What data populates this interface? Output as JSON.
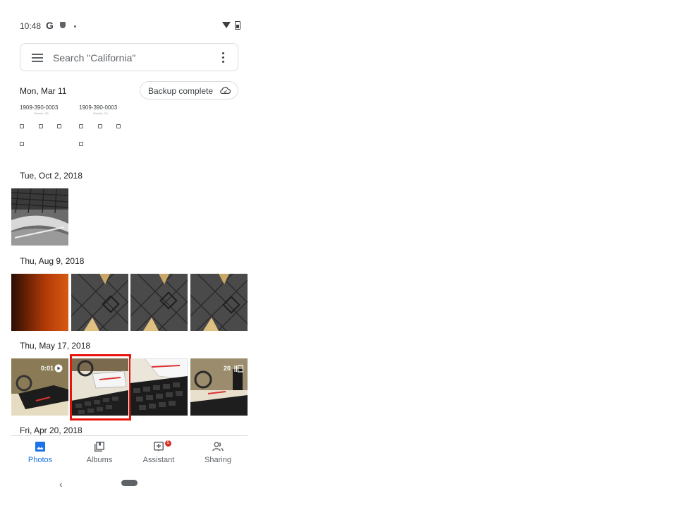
{
  "status_bar": {
    "time": "10:48",
    "g_letter": "G"
  },
  "search": {
    "placeholder": "Search \"California\""
  },
  "sections": {
    "mar11": {
      "date": "Mon, Mar 11",
      "backup_label": "Backup complete",
      "call_number_1": "1909-390-0003",
      "call_number_2": "1909-390-0003",
      "call_location_1": "Ontario, CA",
      "call_location_2": "Ontario, CA"
    },
    "oct2": {
      "date": "Tue, Oct 2, 2018"
    },
    "aug9": {
      "date": "Thu, Aug 9, 2018"
    },
    "may17": {
      "date": "Thu, May 17, 2018",
      "video_duration": "0:01",
      "burst_count": "20"
    },
    "apr20": {
      "date": "Fri, Apr 20, 2018"
    }
  },
  "bottom_nav": {
    "photos": "Photos",
    "albums": "Albums",
    "assistant": "Assistant",
    "assistant_badge": "5",
    "sharing": "Sharing"
  },
  "colors": {
    "accent": "#1a73e8",
    "selection": "#e8140b",
    "notification": "#d93025"
  }
}
